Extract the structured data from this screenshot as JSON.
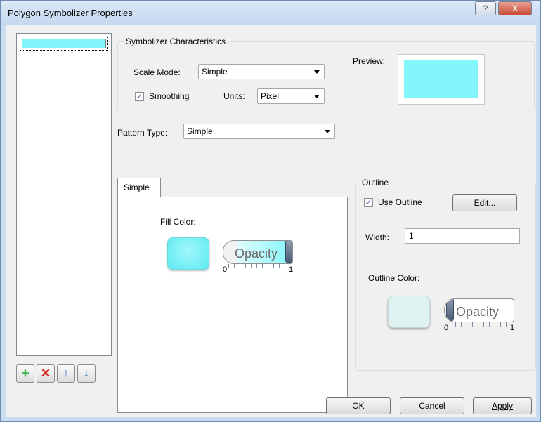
{
  "window": {
    "title": "Polygon Symbolizer Properties",
    "help_glyph": "?",
    "close_glyph": "X"
  },
  "list": {
    "items": [
      {
        "color": "#82f6fa"
      }
    ],
    "buttons": {
      "add_glyph": "+",
      "remove_glyph": "✕",
      "up_glyph": "↑",
      "down_glyph": "↓"
    }
  },
  "symbolizer": {
    "group_title": "Symbolizer Characteristics",
    "scale_mode_label": "Scale Mode:",
    "scale_mode_value": "Simple",
    "smoothing_label": "Smoothing",
    "smoothing_checked": true,
    "units_label": "Units:",
    "units_value": "Pixel",
    "preview_label": "Preview:",
    "preview_color": "#82f6fa"
  },
  "pattern": {
    "label": "Pattern Type:",
    "value": "Simple"
  },
  "tabs": [
    {
      "label": "Simple",
      "selected": true
    }
  ],
  "fill": {
    "label": "Fill Color:",
    "color": "#82f6fa",
    "opacity_text": "Opacity",
    "opacity_min": "0",
    "opacity_max": "1",
    "opacity_value": 1.0
  },
  "outline": {
    "group_title": "Outline",
    "use_outline_label": "Use Outline",
    "use_outline_checked": true,
    "edit_button": "Edit...",
    "width_label": "Width:",
    "width_value": "1",
    "color_label": "Outline Color:",
    "color": "#dff2f2",
    "opacity_text": "Opacity",
    "opacity_min": "0",
    "opacity_max": "1",
    "opacity_value": 0.0
  },
  "footer": {
    "ok": "OK",
    "cancel": "Cancel",
    "apply": "Apply"
  },
  "colors": {
    "accent_check": "#3a55a0",
    "add_green": "#3cb043",
    "remove_red": "#d8261f",
    "arrow_blue": "#2f6fd0"
  }
}
